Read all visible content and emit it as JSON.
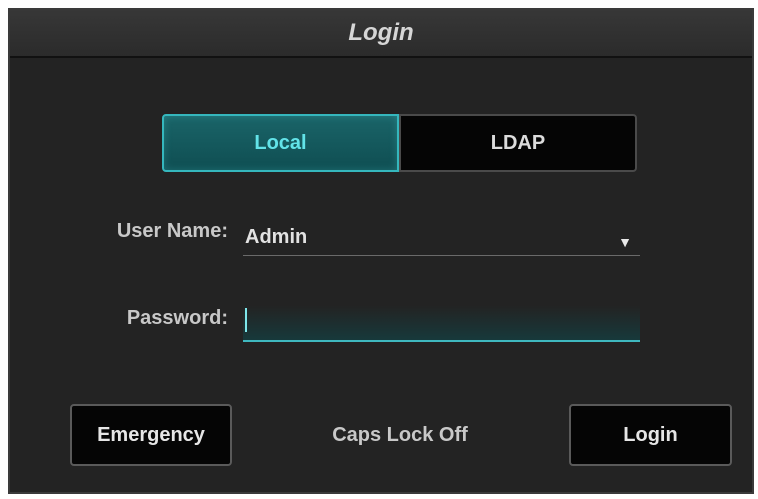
{
  "dialog": {
    "title": "Login"
  },
  "auth_mode": {
    "options": [
      "Local",
      "LDAP"
    ],
    "selected": "Local"
  },
  "form": {
    "username_label": "User Name:",
    "username_value": "Admin",
    "password_label": "Password:",
    "password_value": ""
  },
  "status": {
    "caps_lock": "Caps Lock Off"
  },
  "buttons": {
    "emergency": "Emergency",
    "login": "Login"
  },
  "icons": {
    "dropdown": "triangle-down-icon"
  },
  "colors": {
    "accent": "#35b7bd",
    "background": "#232323"
  }
}
